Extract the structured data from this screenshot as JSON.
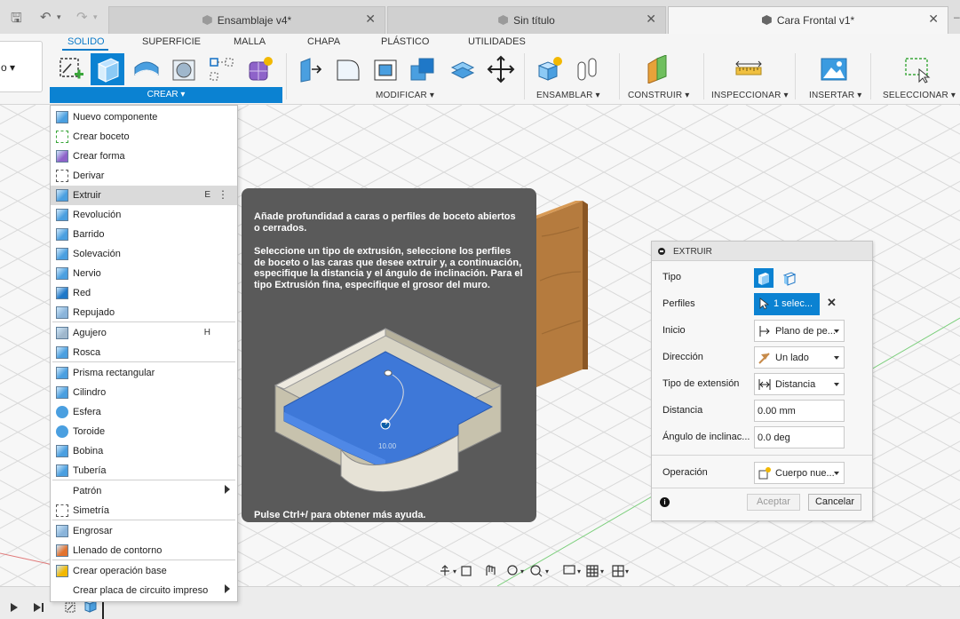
{
  "tabs": [
    {
      "label": "Ensamblaje v4*",
      "active": false
    },
    {
      "label": "Sin título",
      "active": false
    },
    {
      "label": "Cara Frontal v1*",
      "active": true
    }
  ],
  "ribbon": {
    "workspace_label": "o ▾",
    "tabs": [
      "SOLIDO",
      "SUPERFICIE",
      "MALLA",
      "CHAPA",
      "PLÁSTICO",
      "UTILIDADES"
    ],
    "groups": {
      "crear": "CREAR ▾",
      "modificar": "MODIFICAR ▾",
      "ensamblar": "ENSAMBLAR ▾",
      "construir": "CONSTRUIR ▾",
      "inspeccionar": "INSPECCIONAR ▾",
      "insertar": "INSERTAR ▾",
      "seleccionar": "SELECCIONAR ▾"
    }
  },
  "menu": {
    "items": [
      {
        "label": "Nuevo componente",
        "icon": "new-component-icon"
      },
      {
        "label": "Crear boceto",
        "icon": "create-sketch-icon"
      },
      {
        "label": "Crear forma",
        "icon": "create-form-icon"
      },
      {
        "label": "Derivar",
        "icon": "derive-icon"
      },
      {
        "label": "Extruir",
        "icon": "extrude-icon",
        "shortcut": "E",
        "highlighted": true
      },
      {
        "label": "Revolución",
        "icon": "revolve-icon"
      },
      {
        "label": "Barrido",
        "icon": "sweep-icon"
      },
      {
        "label": "Solevación",
        "icon": "loft-icon"
      },
      {
        "label": "Nervio",
        "icon": "rib-icon"
      },
      {
        "label": "Red",
        "icon": "web-icon"
      },
      {
        "label": "Repujado",
        "icon": "emboss-icon"
      },
      {
        "label": "Agujero",
        "icon": "hole-icon",
        "shortcut": "H"
      },
      {
        "label": "Rosca",
        "icon": "thread-icon"
      },
      {
        "label": "Prisma rectangular",
        "icon": "box-icon"
      },
      {
        "label": "Cilindro",
        "icon": "cylinder-icon"
      },
      {
        "label": "Esfera",
        "icon": "sphere-icon"
      },
      {
        "label": "Toroide",
        "icon": "torus-icon"
      },
      {
        "label": "Bobina",
        "icon": "coil-icon"
      },
      {
        "label": "Tubería",
        "icon": "pipe-icon"
      },
      {
        "label": "Patrón",
        "icon": "",
        "submenu": true
      },
      {
        "label": "Simetría",
        "icon": "mirror-icon"
      },
      {
        "label": "Engrosar",
        "icon": "thicken-icon"
      },
      {
        "label": "Llenado de contorno",
        "icon": "boundary-fill-icon"
      },
      {
        "label": "Crear operación base",
        "icon": "base-feature-icon"
      },
      {
        "label": "Crear placa de circuito impreso",
        "icon": "",
        "submenu": true
      }
    ]
  },
  "tooltip": {
    "p1": "Añade profundidad a caras o perfiles de boceto abiertos o cerrados.",
    "p2": "Seleccione un tipo de extrusión, seleccione los perfiles de boceto o las caras que desee extruir y, a continuación, especifique la distancia y el ángulo de inclinación. Para el tipo Extrusión fina, especifique el grosor del muro.",
    "preview_value": "10.00",
    "footer": "Pulse Ctrl+/ para obtener más ayuda."
  },
  "extrude": {
    "title": "EXTRUIR",
    "tipo_label": "Tipo",
    "perfiles_label": "Perfiles",
    "perfiles_value": "1 selec...",
    "inicio_label": "Inicio",
    "inicio_value": "Plano de pe...",
    "direccion_label": "Dirección",
    "direccion_value": "Un lado",
    "tipo_ext_label": "Tipo de extensión",
    "tipo_ext_value": "Distancia",
    "distancia_label": "Distancia",
    "distancia_value": "0.00 mm",
    "angulo_label": "Ángulo de inclinac...",
    "angulo_value": "0.0 deg",
    "operacion_label": "Operación",
    "operacion_value": "Cuerpo nue...",
    "ok_label": "Aceptar",
    "cancel_label": "Cancelar"
  },
  "colors": {
    "accent": "#0b82d2",
    "tooltip_bg": "#5a5a5a",
    "wood": "#b57b3e"
  }
}
